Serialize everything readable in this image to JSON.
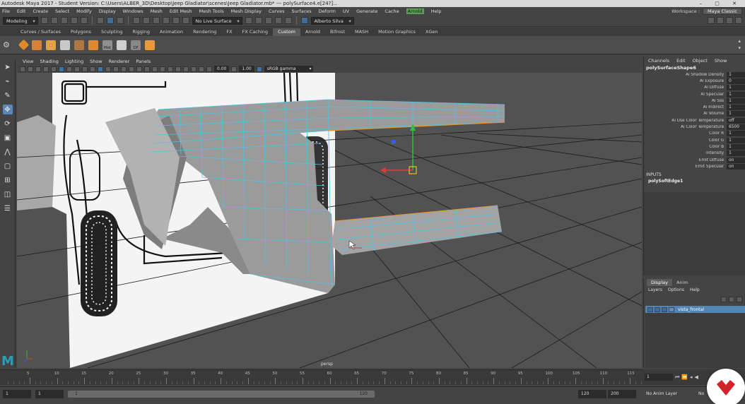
{
  "titlebar": {
    "text": "Autodesk Maya 2017 - Student Version: C:\\Users\\ALBER_3D\\Desktop\\Jeep Gladiator\\scenes\\Jeep Gladiator.mb* --- polySurface4.e[24?]...",
    "controls": "– ▢ ✕"
  },
  "menubar": {
    "items": [
      "File",
      "Edit",
      "Create",
      "Select",
      "Modify",
      "Display",
      "Windows",
      "Mesh",
      "Edit Mesh",
      "Mesh Tools",
      "Mesh Display",
      "Curves",
      "Surfaces",
      "Deform",
      "UV",
      "Generate",
      "Cache",
      "Arnold",
      "Help"
    ],
    "highlighted": "Arnold",
    "workspace_label": "Workspace :",
    "workspace_value": "Maya Classic"
  },
  "statusline": {
    "mode": "Modeling",
    "live_surface": "No Live Surface",
    "user": "Alberto Silva"
  },
  "shelf": {
    "tabs": [
      "Curves / Surfaces",
      "Polygons",
      "Sculpting",
      "Rigging",
      "Animation",
      "Rendering",
      "FX",
      "FX Caching",
      "Custom",
      "Arnold",
      "Bifrost",
      "MASH",
      "Motion Graphics",
      "XGen"
    ],
    "active_tab": "Custom",
    "icon_labels": [
      "Hist",
      "CP"
    ]
  },
  "panel": {
    "menu": [
      "View",
      "Shading",
      "Lighting",
      "Show",
      "Renderer",
      "Panels"
    ],
    "field_a": "0.00",
    "field_b": "1.00",
    "colorspace": "sRGB gamma",
    "camera_label": "persp"
  },
  "channelbox": {
    "menu": [
      "Channels",
      "Edit",
      "Object",
      "Show"
    ],
    "node": "polySurfaceShape6",
    "attributes": [
      {
        "name": "Ai Shadow Density",
        "value": "1"
      },
      {
        "name": "Ai Exposure",
        "value": "0"
      },
      {
        "name": "Ai Diffuse",
        "value": "1"
      },
      {
        "name": "Ai Specular",
        "value": "1"
      },
      {
        "name": "Ai Sss",
        "value": "1"
      },
      {
        "name": "Ai Indirect",
        "value": "1"
      },
      {
        "name": "Ai Volume",
        "value": "1"
      },
      {
        "name": "Ai Use Color Temperature",
        "value": "off"
      },
      {
        "name": "Ai Color Temperature",
        "value": "6500"
      },
      {
        "name": "Color R",
        "value": "1"
      },
      {
        "name": "Color G",
        "value": "1"
      },
      {
        "name": "Color B",
        "value": "1"
      },
      {
        "name": "Intensity",
        "value": "1"
      },
      {
        "name": "Emit Diffuse",
        "value": "on"
      },
      {
        "name": "Emit Specular",
        "value": "on"
      }
    ],
    "inputs_title": "INPUTS",
    "input_node": "polySoftEdge1"
  },
  "layers": {
    "tabs": [
      "Display",
      "Anim"
    ],
    "active_tab": "Display",
    "menu": [
      "Layers",
      "Options",
      "Help"
    ],
    "layer_flags": [
      "V",
      "P",
      ""
    ],
    "layer_name": "vista_frontal"
  },
  "timeline": {
    "ticks": [
      "5",
      "10",
      "15",
      "20",
      "25",
      "30",
      "35",
      "40",
      "45",
      "50",
      "55",
      "60",
      "65",
      "70",
      "75",
      "80",
      "85",
      "90",
      "95",
      "100",
      "105",
      "110",
      "115",
      "120"
    ],
    "current_frame": "1"
  },
  "range": {
    "start": "1",
    "anim_start": "1",
    "slider_start": "1",
    "slider_end": "120",
    "anim_end": "120",
    "end": "200",
    "anim_layer": "No Anim Layer",
    "char_set": "No"
  },
  "colors": {
    "accent_blue": "#5285b4",
    "arnold_green": "#5aa05a",
    "wire_blue": "#4fc3e8",
    "maya_logo": "#2a9fb7",
    "badge_red": "#d2232a"
  }
}
